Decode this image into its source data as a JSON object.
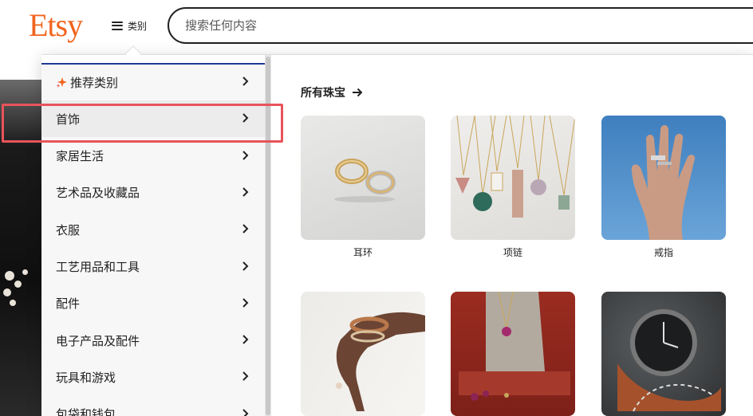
{
  "header": {
    "logo": "Etsy",
    "categories_label": "类别",
    "search_placeholder": "搜索任何内容"
  },
  "sidebar": {
    "items": [
      {
        "label": "推荐类别"
      },
      {
        "label": "首饰"
      },
      {
        "label": "家居生活"
      },
      {
        "label": "艺术品及收藏品"
      },
      {
        "label": "衣服"
      },
      {
        "label": "工艺用品和工具"
      },
      {
        "label": "配件"
      },
      {
        "label": "电子产品及配件"
      },
      {
        "label": "玩具和游戏"
      },
      {
        "label": "包袋和钱包"
      }
    ]
  },
  "content": {
    "title": "所有珠宝",
    "tiles": [
      {
        "label": "耳环"
      },
      {
        "label": "项链"
      },
      {
        "label": "戒指"
      },
      {
        "label": ""
      },
      {
        "label": ""
      },
      {
        "label": ""
      }
    ]
  },
  "colors": {
    "brand": "#f1641e",
    "highlight": "#e8545b",
    "sidebar_top_border": "#1f3a93"
  }
}
